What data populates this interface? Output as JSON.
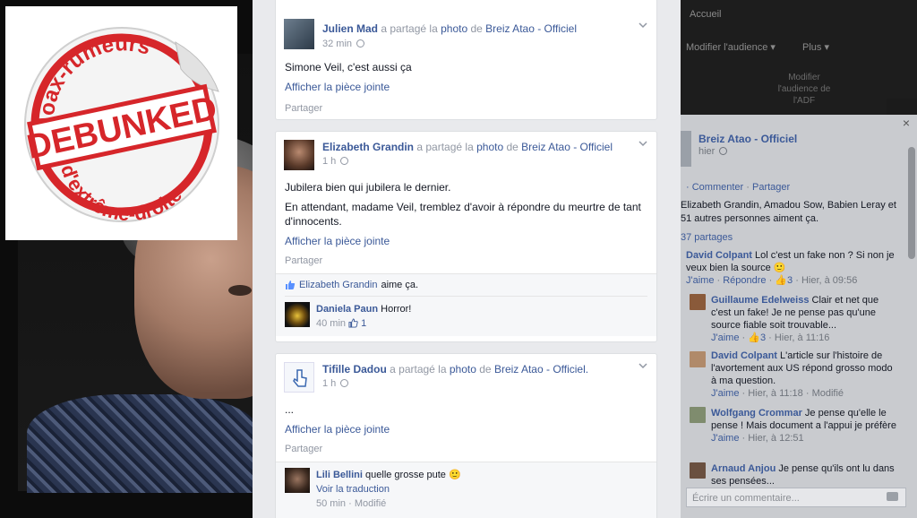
{
  "sticker": {
    "top_text": "Hoax-rumeurs",
    "main_text": "DEBUNKED",
    "bottom_text": "d'extrême-droite",
    "color": "#d6262a"
  },
  "posts": [
    {
      "author": "Julien Mad",
      "shared_text": "a partagé la",
      "photo_word": "photo",
      "of_word": "de",
      "page": "Breiz Atao - Officiel",
      "time": "32 min",
      "body": [
        "Simone Veil, c'est aussi ça"
      ],
      "attachment": "Afficher la pièce jointe",
      "share": "Partager"
    },
    {
      "author": "Elizabeth Grandin",
      "shared_text": "a partagé la",
      "photo_word": "photo",
      "of_word": "de",
      "page": "Breiz Atao - Officiel",
      "time": "1 h",
      "body": [
        "Jubilera bien qui jubilera le dernier.",
        "En attendant, madame Veil, tremblez d'avoir à répondre du meurtre de tant d'innocents."
      ],
      "attachment": "Afficher la pièce jointe",
      "share": "Partager",
      "like_line": {
        "name": "Elizabeth Grandin",
        "text": "aime ça."
      },
      "comment": {
        "name": "Daniela Paun",
        "text": "Horror!",
        "time": "40 min",
        "likes": "1"
      }
    },
    {
      "author": "Tifille Dadou",
      "shared_text": "a partagé la",
      "photo_word": "photo",
      "of_word": "de",
      "page": "Breiz Atao - Officiel.",
      "time": "1 h",
      "body": [
        "..."
      ],
      "attachment": "Afficher la pièce jointe",
      "share": "Partager",
      "comment": {
        "name": "Lili Bellini",
        "text": "quelle grosse pute",
        "translate": "Voir la traduction",
        "time": "50 min",
        "modified": "Modifié"
      }
    }
  ],
  "side_top": {
    "nav": "Accueil",
    "btn1": "Modifier l'audience ▾",
    "btn2": "Plus ▾",
    "small": "Modifier l'audience de l'ADF"
  },
  "side": {
    "page_name": "Breiz Atao - Officiel",
    "page_time": "hier",
    "comment_action": "Commenter",
    "share_action": "Partager",
    "likers": "Elizabeth Grandin, Amadou Sow, Babien Leray et 51 autres personnes aiment ça.",
    "shares": "37 partages",
    "comments": [
      {
        "name": "David Colpant",
        "text": "Lol c'est un fake non ? Si non je veux bien la source 🙂",
        "like": "J'aime",
        "reply": "Répondre",
        "likes": "3",
        "time": "Hier, à 09:56"
      },
      {
        "name": "Guillaume Edelweiss",
        "text": "Clair et net que c'est un fake! Je ne pense pas qu'une source fiable soit trouvable...",
        "like": "J'aime",
        "likes": "3",
        "time": "Hier, à 11:16"
      },
      {
        "name": "David Colpant",
        "text": "L'article sur l'histoire de l'avortement aux US répond grosso modo à ma question.",
        "like": "J'aime",
        "time": "Hier, à 11:18",
        "modified": "Modifié"
      },
      {
        "name": "Wolfgang Crommar",
        "text": "Je pense qu'elle le pense ! Mais document a l'appui je préfère",
        "like": "J'aime",
        "time": "Hier, à 12:51"
      },
      {
        "name": "Arnaud Anjou",
        "text": "Je pense qu'ils ont lu dans ses pensées...",
        "like": "",
        "time": ""
      }
    ],
    "write_placeholder": "Écrire un commentaire..."
  }
}
